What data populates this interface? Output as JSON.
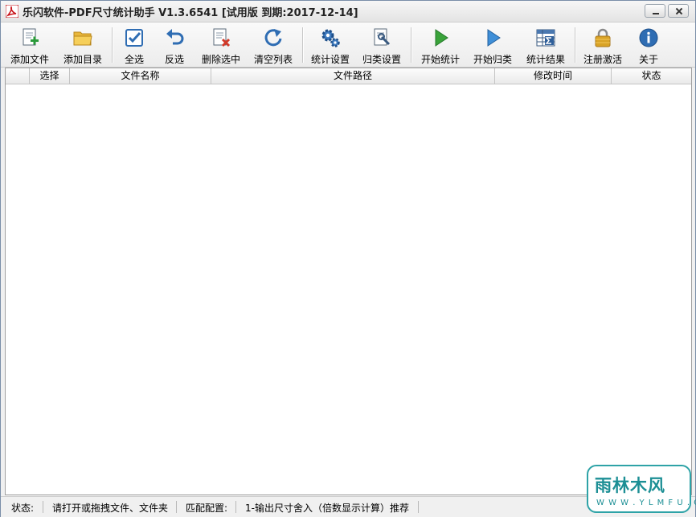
{
  "window": {
    "title": "乐闪软件-PDF尺寸统计助手 V1.3.6541 [试用版 到期:2017-12-14]",
    "controls": [
      "minimize",
      "close"
    ]
  },
  "toolbar": {
    "items": [
      {
        "id": "add-file",
        "label": "添加文件",
        "icon": "add-file-icon"
      },
      {
        "id": "add-folder",
        "label": "添加目录",
        "icon": "folder-icon"
      },
      {
        "id": "select-all",
        "label": "全选",
        "icon": "checkbox-icon"
      },
      {
        "id": "invert",
        "label": "反选",
        "icon": "undo-arrow-icon"
      },
      {
        "id": "delete-selected",
        "label": "删除选中",
        "icon": "delete-document-icon"
      },
      {
        "id": "clear-list",
        "label": "清空列表",
        "icon": "refresh-icon"
      },
      {
        "id": "stat-settings",
        "label": "统计设置",
        "icon": "gears-icon"
      },
      {
        "id": "classify-settings",
        "label": "归类设置",
        "icon": "document-wrench-icon"
      },
      {
        "id": "start-stat",
        "label": "开始统计",
        "icon": "play-green-icon"
      },
      {
        "id": "start-classify",
        "label": "开始归类",
        "icon": "play-blue-icon"
      },
      {
        "id": "stat-results",
        "label": "统计结果",
        "icon": "table-sigma-icon"
      },
      {
        "id": "register",
        "label": "注册激活",
        "icon": "lock-icon"
      },
      {
        "id": "about",
        "label": "关于",
        "icon": "info-icon"
      }
    ]
  },
  "table": {
    "columns": [
      "选择",
      "文件名称",
      "文件路径",
      "修改时间",
      "状态"
    ],
    "rows": []
  },
  "statusbar": {
    "label": "状态:",
    "message": "请打开或拖拽文件、文件夹",
    "config_label": "匹配配置:",
    "config_value": "1-输出尺寸舍入（倍数显示计算）推荐"
  },
  "watermark": {
    "main": "雨林木风",
    "sub": "W W W . Y L M F U . C O M"
  },
  "colors": {
    "accent_blue": "#2f6db3",
    "play_green": "#3aa33a",
    "play_blue": "#3f8fd8",
    "lock_gold": "#d9a326",
    "watermark_teal": "#1c8f95",
    "pdf_red": "#c8151b"
  }
}
